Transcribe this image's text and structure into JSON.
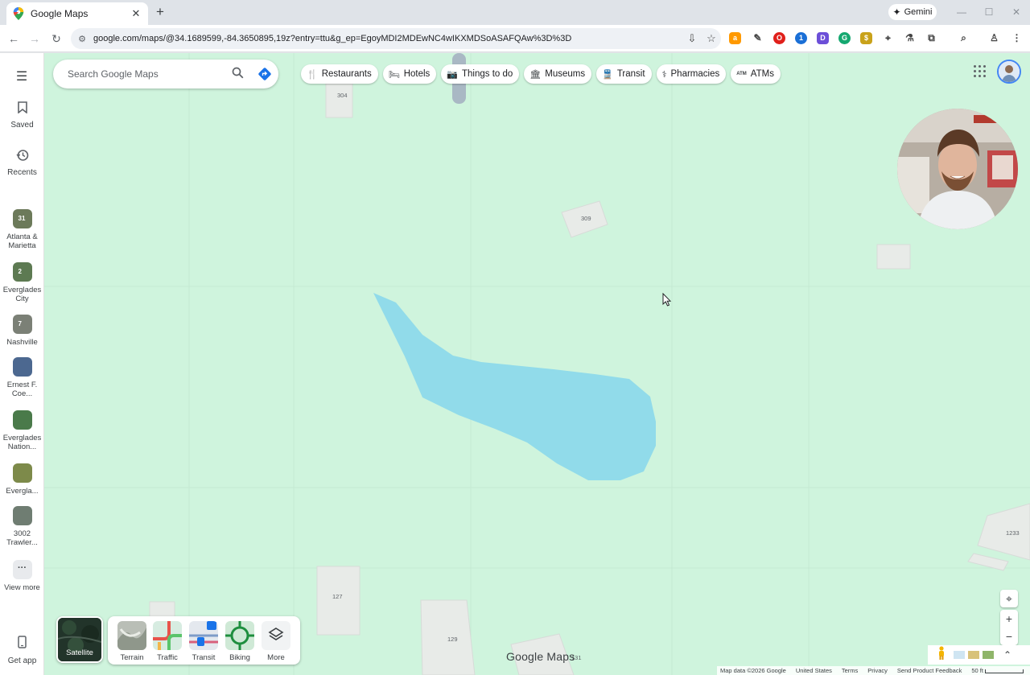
{
  "browser": {
    "tab_title": "Google Maps",
    "tab_close": "✕",
    "new_tab": "+",
    "gemini_label": "Gemini",
    "url": "google.com/maps/@34.1689599,-84.3650895,19z?entry=ttu&g_ep=EgoyMDI2MDEwNC4wIKXMDSoASAFQAw%3D%3D",
    "window_controls": [
      "minimize",
      "maximize",
      "close"
    ],
    "extension_icons": [
      "amazon-icon",
      "pen-icon",
      "opera-icon",
      "onepassword-icon",
      "d-icon",
      "grammarly-icon",
      "coupon-icon",
      "maps-pin-icon",
      "flask-icon",
      "puzzle-icon",
      "tab-search-icon",
      "profile-icon",
      "menu-icon"
    ]
  },
  "rail": {
    "saved_label": "Saved",
    "recents_label": "Recents",
    "recent_items": [
      {
        "label": "Atlanta & Marietta",
        "count": "31",
        "color": "#6c7a5a"
      },
      {
        "label": "Everglades City",
        "count": "2",
        "color": "#5d7a52"
      },
      {
        "label": "Nashville",
        "count": "7",
        "color": "#7b8076"
      },
      {
        "label": "Ernest F. Coe...",
        "count": "",
        "color": "#4c6890"
      },
      {
        "label": "Everglades Nation...",
        "count": "",
        "color": "#4a7a4a"
      },
      {
        "label": "Evergla...",
        "count": "",
        "color": "#7d8a4a"
      },
      {
        "label": "3002 Trawler...",
        "count": "",
        "color": "#6f7d72"
      }
    ],
    "view_more_label": "View more",
    "get_app_label": "Get app"
  },
  "search": {
    "placeholder": "Search Google Maps"
  },
  "chips": [
    {
      "label": "Restaurants",
      "icon": "fork-knife-icon",
      "glyph": "🍴"
    },
    {
      "label": "Hotels",
      "icon": "bed-icon",
      "glyph": "🛏"
    },
    {
      "label": "Things to do",
      "icon": "camera-icon",
      "glyph": "📷"
    },
    {
      "label": "Museums",
      "icon": "museum-icon",
      "glyph": "🏛"
    },
    {
      "label": "Transit",
      "icon": "train-icon",
      "glyph": "🚆"
    },
    {
      "label": "Pharmacies",
      "icon": "pharmacy-icon",
      "glyph": "⚕"
    },
    {
      "label": "ATMs",
      "icon": "atm-icon",
      "glyph": "ATM"
    }
  ],
  "map": {
    "building_labels": [
      "304",
      "309",
      "127",
      "129",
      "131",
      "1233"
    ],
    "logo_text": "Google Maps",
    "colors": {
      "land": "#cff4dd",
      "water": "#91dbea",
      "building": "#e8ebe8"
    }
  },
  "layers": {
    "satellite_label": "Satellite",
    "options": [
      "Terrain",
      "Traffic",
      "Transit",
      "Biking",
      "More"
    ]
  },
  "attribution": {
    "map_data": "Map data ©2026 Google",
    "country": "United States",
    "terms": "Terms",
    "privacy": "Privacy",
    "feedback": "Send Product Feedback",
    "scale": "50 ft"
  }
}
